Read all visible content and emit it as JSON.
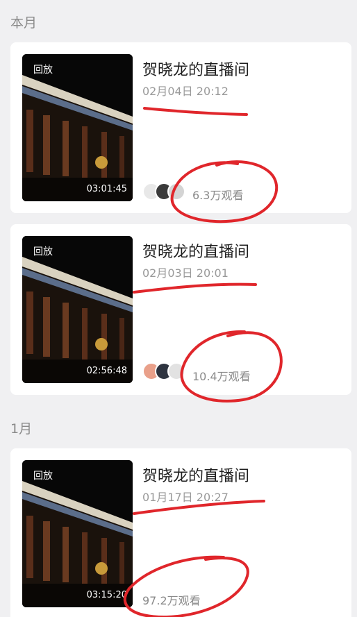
{
  "sections": [
    {
      "title": "本月"
    },
    {
      "title": "1月"
    }
  ],
  "replays": [
    {
      "badge": "回放",
      "duration": "03:01:45",
      "title": "贺晓龙的直播间",
      "date": "02月04日 20:12",
      "views": "6.3万观看"
    },
    {
      "badge": "回放",
      "duration": "02:56:48",
      "title": "贺晓龙的直播间",
      "date": "02月03日 20:01",
      "views": "10.4万观看"
    },
    {
      "badge": "回放",
      "duration": "03:15:20",
      "title": "贺晓龙的直播间",
      "date": "01月17日 20:27",
      "views": "97.2万观看"
    }
  ],
  "colors": {
    "annotation": "#e0262b",
    "background": "#f0f0f2",
    "card": "#ffffff"
  }
}
